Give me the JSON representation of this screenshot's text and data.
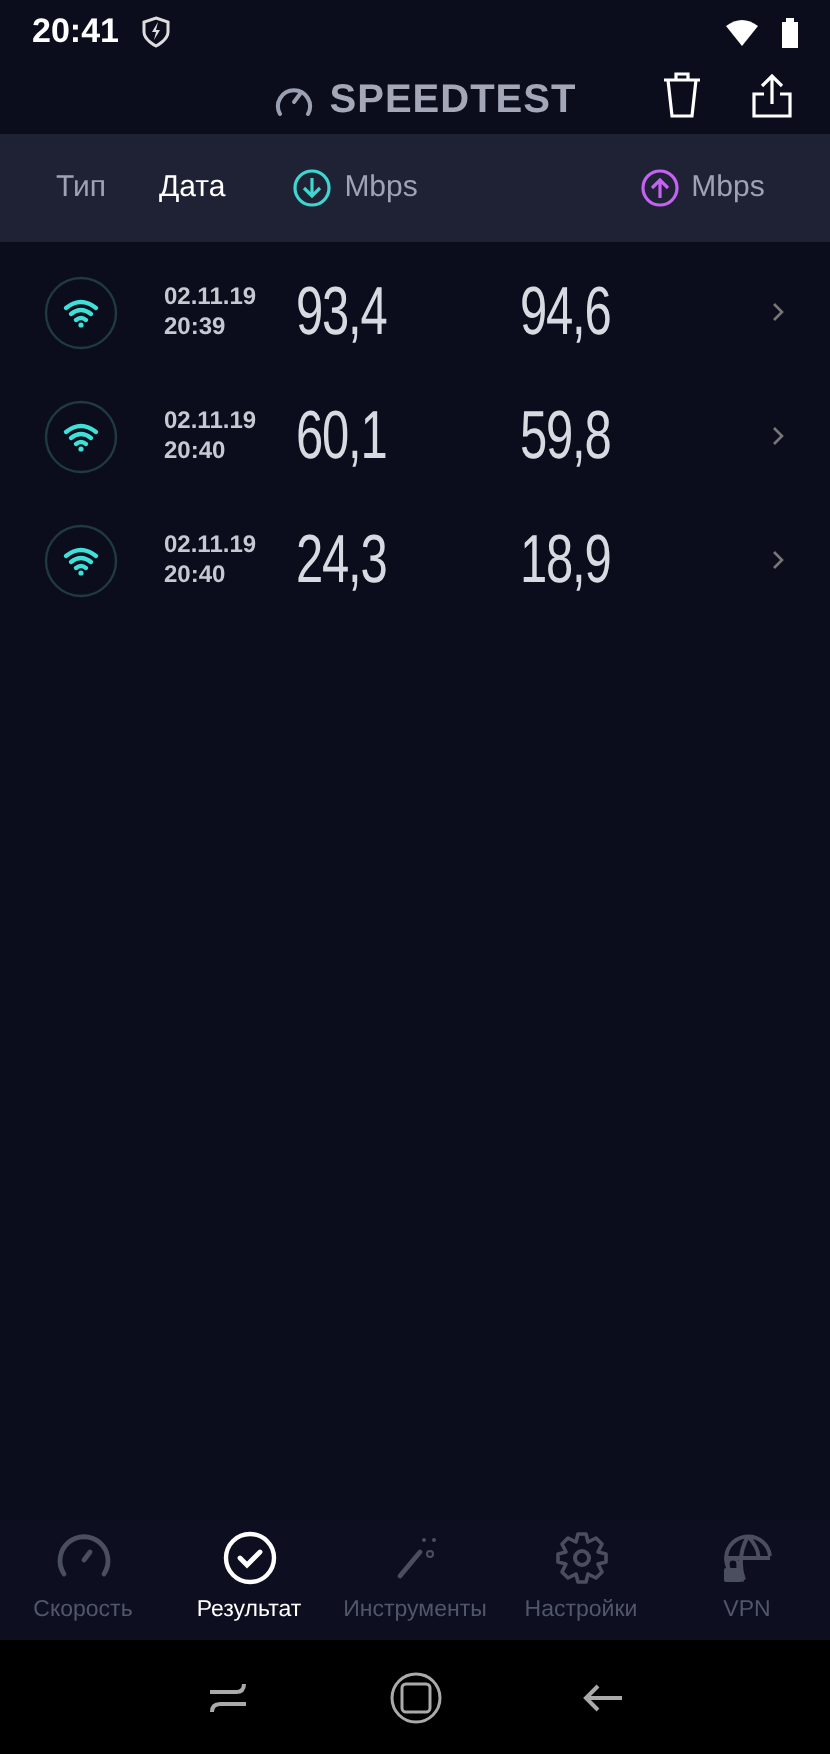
{
  "status_bar": {
    "time": "20:41"
  },
  "app_bar": {
    "title": "SPEEDTEST"
  },
  "columns": [
    {
      "label": "Тип",
      "kind": "text",
      "selected": false
    },
    {
      "label": "Дата",
      "kind": "text",
      "selected": true
    },
    {
      "label": "Mbps",
      "kind": "download",
      "selected": false
    },
    {
      "label": "Mbps",
      "kind": "upload",
      "selected": false
    }
  ],
  "results": [
    {
      "date": "02.11.19",
      "time": "20:39",
      "download": "93,4",
      "upload": "94,6"
    },
    {
      "date": "02.11.19",
      "time": "20:40",
      "download": "60,1",
      "upload": "59,8"
    },
    {
      "date": "02.11.19",
      "time": "20:40",
      "download": "24,3",
      "upload": "18,9"
    }
  ],
  "tabs": [
    {
      "label": "Скорость",
      "kind": "speed",
      "selected": false
    },
    {
      "label": "Результат",
      "kind": "results",
      "selected": true
    },
    {
      "label": "Инструменты",
      "kind": "tools",
      "selected": false
    },
    {
      "label": "Настройки",
      "kind": "settings",
      "selected": false
    },
    {
      "label": "VPN",
      "kind": "vpn",
      "selected": false
    }
  ]
}
